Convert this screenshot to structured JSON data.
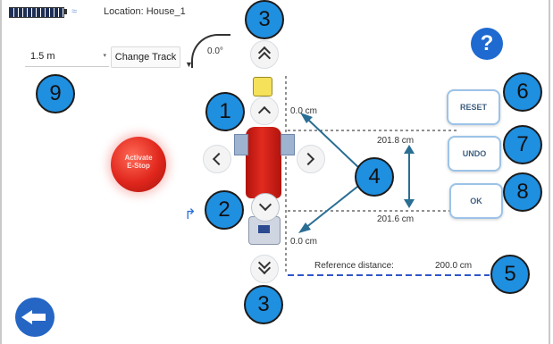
{
  "status": {
    "location": "Location: House_1",
    "battery_icon": "battery-icon",
    "signal_icon": "signal-icon"
  },
  "controls": {
    "distance_select": "1.5 m",
    "change_track": "Change Track",
    "rotation": "0.0°",
    "estop_line1": "Activate",
    "estop_line2": "E-Stop",
    "help": "?"
  },
  "buttons": {
    "reset": "RESET",
    "undo": "UNDO",
    "ok": "OK"
  },
  "measurements": {
    "top": "0.0 cm",
    "upper": "201.8 cm",
    "lower": "201.6 cm",
    "bottom": "0.0 cm",
    "reference_label": "Reference distance:",
    "reference_value": "200.0 cm"
  },
  "callouts": {
    "c1": "1",
    "c2": "2",
    "c3_top": "3",
    "c3_bottom": "3",
    "c4": "4",
    "c5": "5",
    "c6": "6",
    "c7": "7",
    "c8": "8",
    "c9": "9"
  },
  "colors": {
    "accent": "#1f8fe0",
    "nav_blue": "#2566c4",
    "estop_red": "#e0261c",
    "dashed_blue": "#2f55c8"
  }
}
